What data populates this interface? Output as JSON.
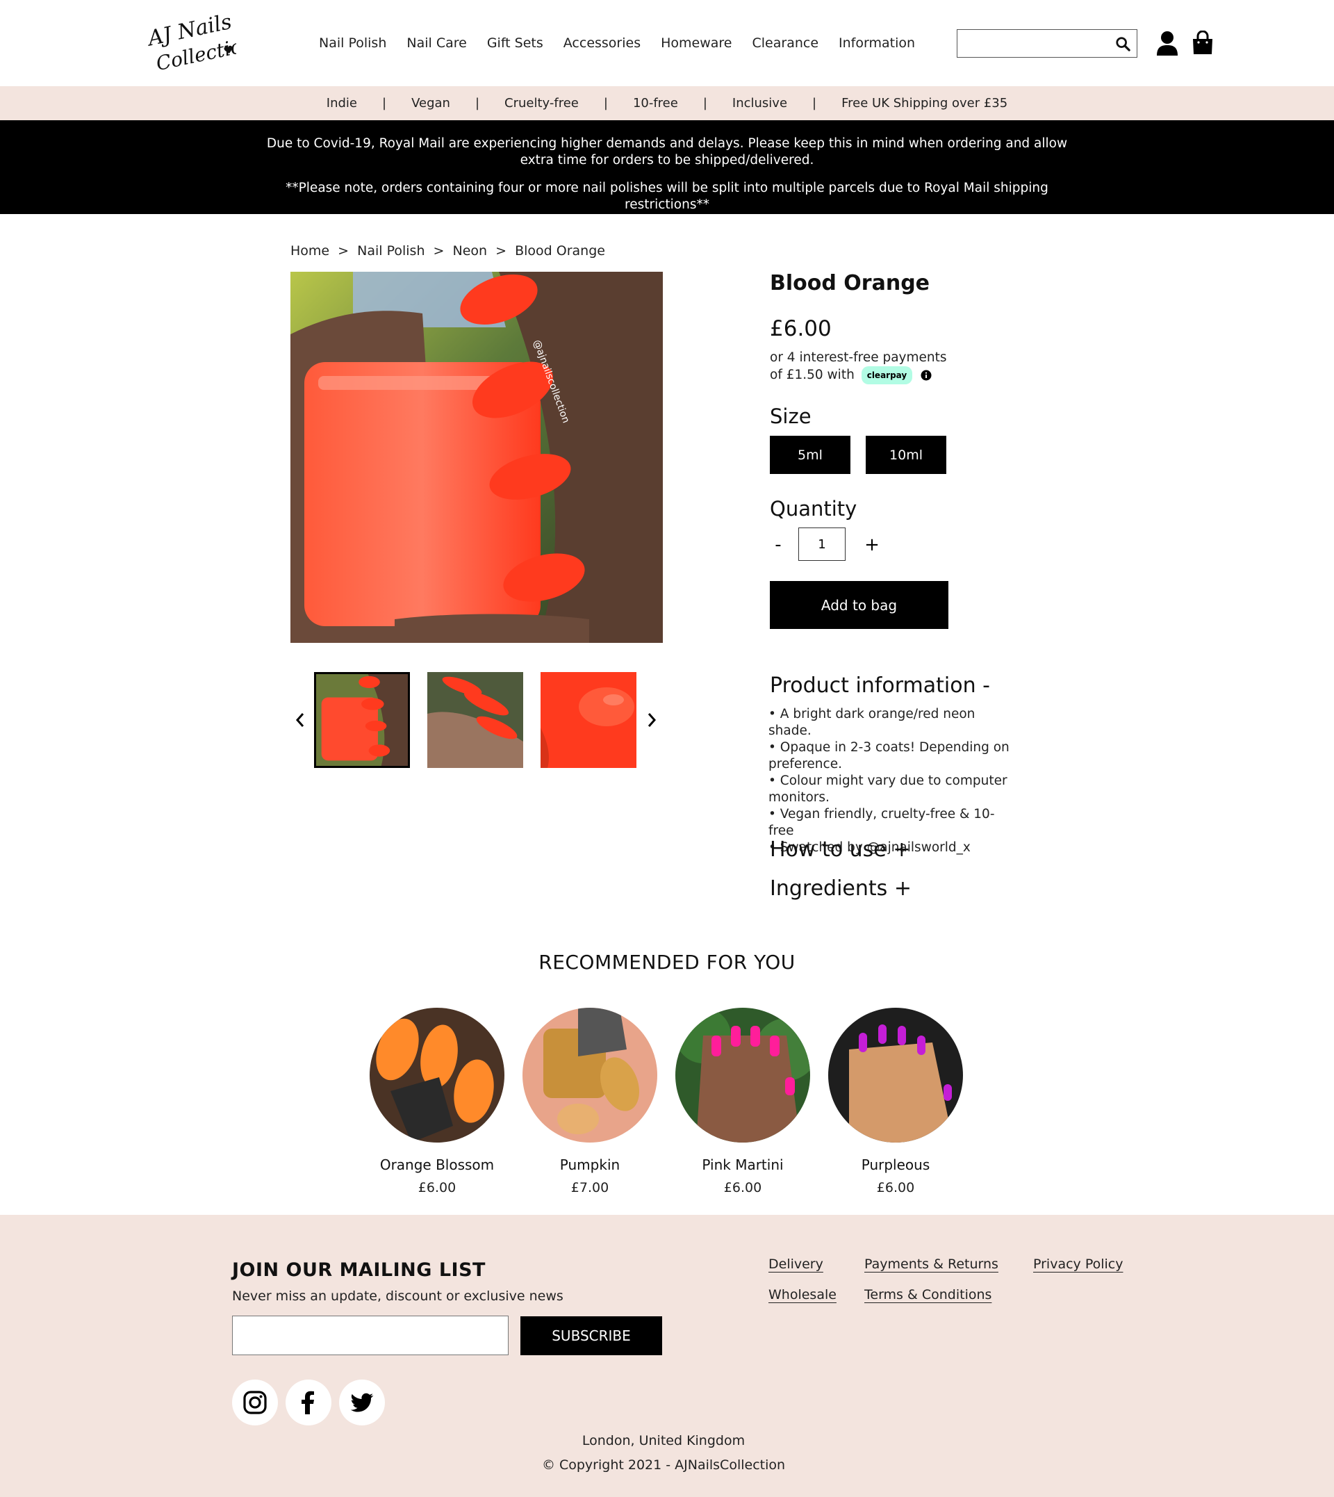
{
  "brand": {
    "logo_text": "AJ Nails Collection"
  },
  "nav": {
    "items": [
      "Nail Polish",
      "Nail Care",
      "Gift Sets",
      "Accessories",
      "Homeware",
      "Clearance",
      "Information"
    ]
  },
  "search": {
    "value": "",
    "placeholder": ""
  },
  "values_bar": {
    "items": [
      "Indie",
      "Vegan",
      "Cruelty-free",
      "10-free",
      "Inclusive",
      "Free UK Shipping over £35"
    ],
    "separator": "|"
  },
  "notice": {
    "line1": "Due to Covid-19, Royal Mail are experiencing higher demands and delays. Please keep this in mind when ordering and allow extra time for orders to be shipped/delivered.",
    "line2": "**Please note, orders containing four or more nail polishes will be split into multiple parcels due to Royal Mail shipping restrictions**"
  },
  "breadcrumb": {
    "items": [
      "Home",
      ">",
      "Nail Polish",
      ">",
      "Neon",
      ">",
      "Blood Orange"
    ]
  },
  "product": {
    "title": "Blood Orange",
    "price": "£6.00",
    "installments_line1": "or 4 interest-free payments",
    "installments_line2": "of £1.50 with",
    "clearpay_label": "clearpay",
    "watermark": "@ajnailscollection",
    "size_label": "Size",
    "sizes": [
      "5ml",
      "10ml"
    ],
    "quantity_label": "Quantity",
    "qty_minus": "-",
    "qty_plus": "+",
    "quantity_value": "1",
    "add_to_bag": "Add to bag",
    "info_title": "Product information -",
    "info_bullets": [
      "• A bright dark orange/red neon shade.",
      "• Opaque in 2-3 coats! Depending on preference.",
      "• Colour might vary due to computer monitors.",
      "• Vegan friendly, cruelty-free & 10-free",
      "• Swatched by @ajnailsworld_x"
    ],
    "how_to_use": "How to use +",
    "ingredients": "Ingredients +"
  },
  "recommended": {
    "title": "RECOMMENDED FOR YOU",
    "items": [
      {
        "name": "Orange Blossom",
        "price": "£6.00"
      },
      {
        "name": "Pumpkin",
        "price": "£7.00"
      },
      {
        "name": "Pink Martini",
        "price": "£6.00"
      },
      {
        "name": "Purpleous",
        "price": "£6.00"
      }
    ]
  },
  "footer": {
    "mailing_title": "JOIN OUR MAILING LIST",
    "mailing_sub": "Never miss an update, discount or exclusive news",
    "email_value": "",
    "subscribe": "SUBSCRIBE",
    "links": [
      "Delivery",
      "Payments & Returns",
      "Privacy Policy",
      "Wholesale",
      "Terms & Conditions"
    ],
    "location": "London, United Kingdom",
    "copyright": "© Copyright 2021 - AJNailsCollection"
  },
  "colors": {
    "accent": "#000000",
    "band": "#f3e4de",
    "polish_orange": "#ff3a1e",
    "clearpay_mint": "#b2fce4"
  },
  "icons": [
    "search-icon",
    "account-icon",
    "shopping-bag-icon",
    "info-icon",
    "chevron-left-icon",
    "chevron-right-icon",
    "instagram-icon",
    "facebook-icon",
    "twitter-icon"
  ]
}
